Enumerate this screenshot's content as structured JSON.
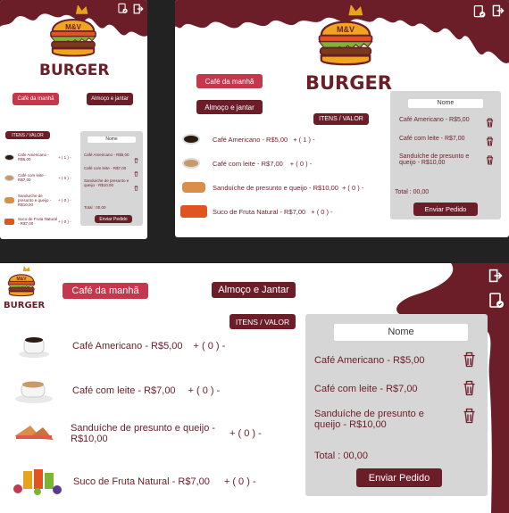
{
  "logo": {
    "badge": "M&V",
    "word": "BURGER"
  },
  "buttons": {
    "breakfast_mobile": "Café da manhã",
    "lunch_mobile": "Almoço e jantar",
    "breakfast_tablet": "Café da manhã",
    "lunch_tablet": "Almoço e jantar",
    "breakfast_desktop": "Café da manhã",
    "lunch_desktop": "Almoço e Jantar",
    "items_value": "ITENS / VALOR",
    "send": "Enviar Pedido"
  },
  "menu": [
    {
      "name": "Café Americano - R$5,00",
      "icon": "coffee-cup-icon"
    },
    {
      "name": "Café com leite - R$7,00",
      "icon": "latte-cup-icon"
    },
    {
      "name": "Sanduíche de presunto e queijo - R$10,00",
      "icon": "sandwich-icon"
    },
    {
      "name": "Suco de Fruta Natural - R$7,00",
      "icon": "fruit-juice-icon"
    }
  ],
  "qty_mobile": [
    "+ ( 1 ) -",
    "+ ( 0 ) -",
    "+ ( 0 ) -",
    "+ ( 0 ) -"
  ],
  "qty_tablet": [
    "+ ( 1 ) -",
    "+ ( 0 ) -",
    "+ ( 0 ) -",
    "+ ( 0 ) -"
  ],
  "qty_desktop": [
    "+ ( 0 ) -",
    "+ ( 0 ) -",
    "+ ( 0 ) -",
    "+ ( 0 ) -"
  ],
  "mobile_menu_names": [
    "Cafe Americano - R$5,00",
    "Café com leite - R$7,00",
    "Sanduíche de presunto e queijo - R$10,00",
    "Suco de Fruta Natural - R$7,00"
  ],
  "cart": {
    "header": "Nome",
    "items": [
      "Café Americano - R$5,00",
      "Café com leite - R$7,00",
      "Sanduíche de presunto e queijo - R$10,00"
    ],
    "total": "Total : 00,00"
  },
  "colors": {
    "brand": "#6b1d28",
    "accent": "#c4374c",
    "panel": "#d6d6d6"
  }
}
